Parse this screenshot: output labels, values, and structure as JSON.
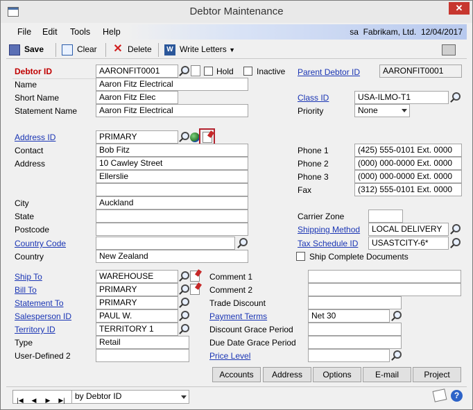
{
  "window": {
    "title": "Debtor Maintenance"
  },
  "menu": {
    "file": "File",
    "edit": "Edit",
    "tools": "Tools",
    "help": "Help",
    "user": "sa",
    "company": "Fabrikam, Ltd.",
    "date": "12/04/2017"
  },
  "toolbar": {
    "save": "Save",
    "clear": "Clear",
    "delete": "Delete",
    "write_letters": "Write Letters"
  },
  "header": {
    "debtor_id_label": "Debtor ID",
    "debtor_id": "AARONFIT0001",
    "hold_label": "Hold",
    "inactive_label": "Inactive",
    "parent_label": "Parent Debtor ID",
    "parent_value": "AARONFIT0001",
    "name_label": "Name",
    "name": "Aaron Fitz Electrical",
    "short_name_label": "Short Name",
    "short_name": "Aaron Fitz Elec",
    "statement_name_label": "Statement Name",
    "statement_name": "Aaron Fitz Electrical",
    "class_id_label": "Class ID",
    "class_id": "USA-ILMO-T1",
    "priority_label": "Priority",
    "priority": "None"
  },
  "address": {
    "address_id_label": "Address ID",
    "address_id": "PRIMARY",
    "contact_label": "Contact",
    "contact": "Bob Fitz",
    "address_label": "Address",
    "address1": "10 Cawley Street",
    "address2": "Ellerslie",
    "address3": "",
    "city_label": "City",
    "city": "Auckland",
    "state_label": "State",
    "state": "",
    "postcode_label": "Postcode",
    "postcode": "",
    "country_code_label": "Country Code",
    "country_code": "",
    "country_label": "Country",
    "country": "New Zealand"
  },
  "phones": {
    "phone1_label": "Phone 1",
    "phone1": "(425) 555-0101  Ext. 0000",
    "phone2_label": "Phone 2",
    "phone2": "(000) 000-0000  Ext. 0000",
    "phone3_label": "Phone 3",
    "phone3": "(000) 000-0000  Ext. 0000",
    "fax_label": "Fax",
    "fax": "(312) 555-0101  Ext. 0000",
    "carrier_zone_label": "Carrier Zone",
    "carrier_zone": "",
    "shipping_method_label": "Shipping Method",
    "shipping_method": "LOCAL DELIVERY",
    "tax_schedule_label": "Tax Schedule ID",
    "tax_schedule": "USASTCITY-6*",
    "ship_complete_label": "Ship Complete Documents"
  },
  "lower_left": {
    "ship_to_label": "Ship To",
    "ship_to": "WAREHOUSE",
    "bill_to_label": "Bill To",
    "bill_to": "PRIMARY",
    "statement_to_label": "Statement To",
    "statement_to": "PRIMARY",
    "salesperson_label": "Salesperson ID",
    "salesperson": "PAUL W.",
    "territory_label": "Territory ID",
    "territory": "TERRITORY 1",
    "type_label": "Type",
    "type": "Retail",
    "user_defined_label": "User-Defined 2",
    "user_defined": ""
  },
  "lower_right": {
    "comment1_label": "Comment 1",
    "comment1": "",
    "comment2_label": "Comment 2",
    "comment2": "",
    "trade_discount_label": "Trade Discount",
    "trade_discount": "",
    "payment_terms_label": "Payment Terms",
    "payment_terms": "Net 30",
    "discount_grace_label": "Discount Grace Period",
    "discount_grace": "",
    "due_date_grace_label": "Due Date Grace Period",
    "due_date_grace": "",
    "price_level_label": "Price Level",
    "price_level": ""
  },
  "buttons": {
    "accounts": "Accounts",
    "address": "Address",
    "options": "Options",
    "email": "E-mail",
    "project": "Project"
  },
  "statusbar": {
    "sort": "by Debtor ID",
    "first": "|◀",
    "prev": "◀",
    "next": "▶",
    "last": "▶|"
  }
}
